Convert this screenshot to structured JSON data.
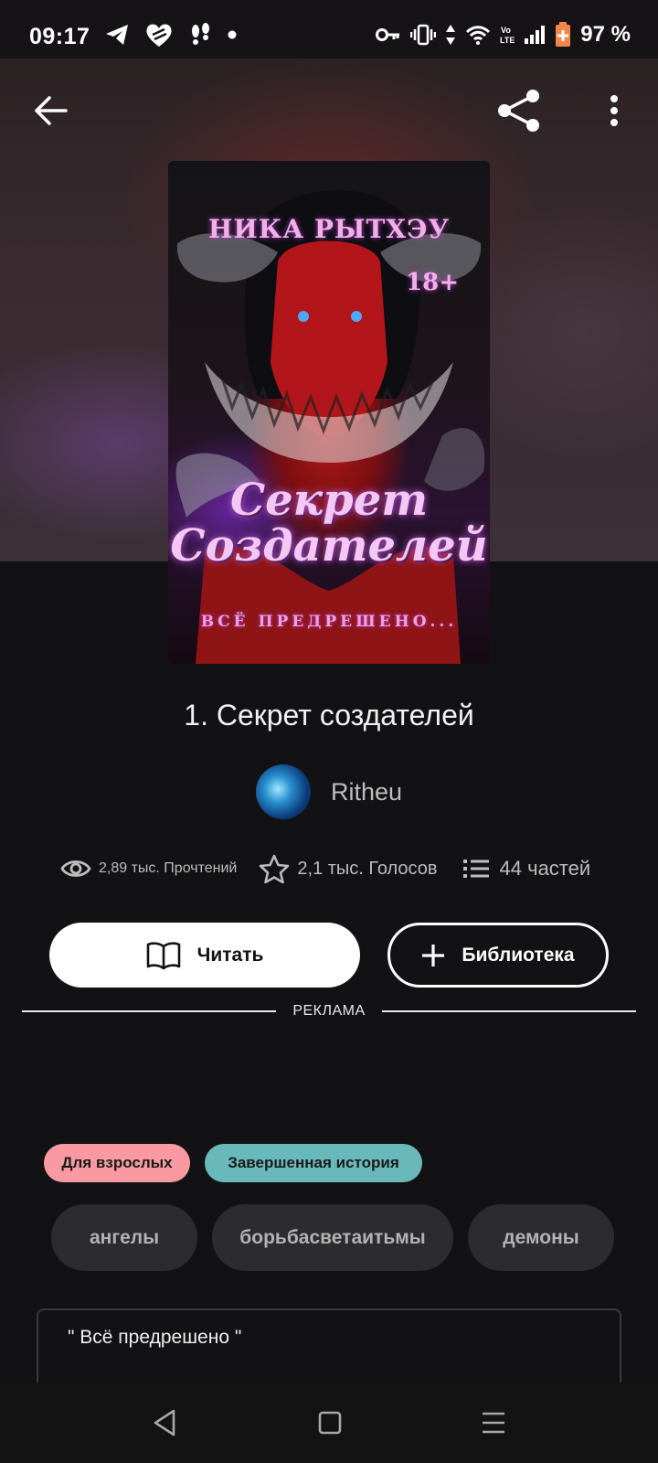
{
  "status_bar": {
    "time": "09:17",
    "battery": "97 %",
    "left_icons": [
      "telegram-icon",
      "heart-app-icon",
      "footsteps-icon",
      "dot-icon"
    ],
    "right_icons": [
      "key-icon",
      "vibrate-icon",
      "data-arrows-icon",
      "wifi-icon",
      "volte-icon",
      "signal-icon",
      "battery-icon"
    ]
  },
  "topbar": {
    "icons": [
      "back-arrow-icon",
      "share-icon",
      "more-vertical-icon"
    ]
  },
  "cover": {
    "author": "НИКА РЫТХЭУ",
    "age": "18+",
    "title_line1": "Секрет",
    "title_line2": "Создателей",
    "tagline": "ВСЁ ПРЕДРЕШЕНО..."
  },
  "book": {
    "title": "1. Секрет создателей"
  },
  "author": {
    "name": "Ritheu"
  },
  "stats": {
    "reads": "2,89 тыс. Прочтений",
    "votes": "2,1 тыс. Голосов",
    "parts": "44 частей"
  },
  "actions": {
    "read_label": "Читать",
    "library_label": "Библиотека"
  },
  "ad": {
    "label": "РЕКЛАМА"
  },
  "badges": {
    "adult": "Для взрослых",
    "complete": "Завершенная история"
  },
  "tags": [
    "ангелы",
    "борьбасветаитьмы",
    "демоны"
  ],
  "description": {
    "text": "\" Всё предрешено \""
  },
  "colors": {
    "background": "#121113",
    "badge_adult": "#f99aa3",
    "badge_complete": "#6ab9ba",
    "tag_bg": "#2c2b2e"
  }
}
